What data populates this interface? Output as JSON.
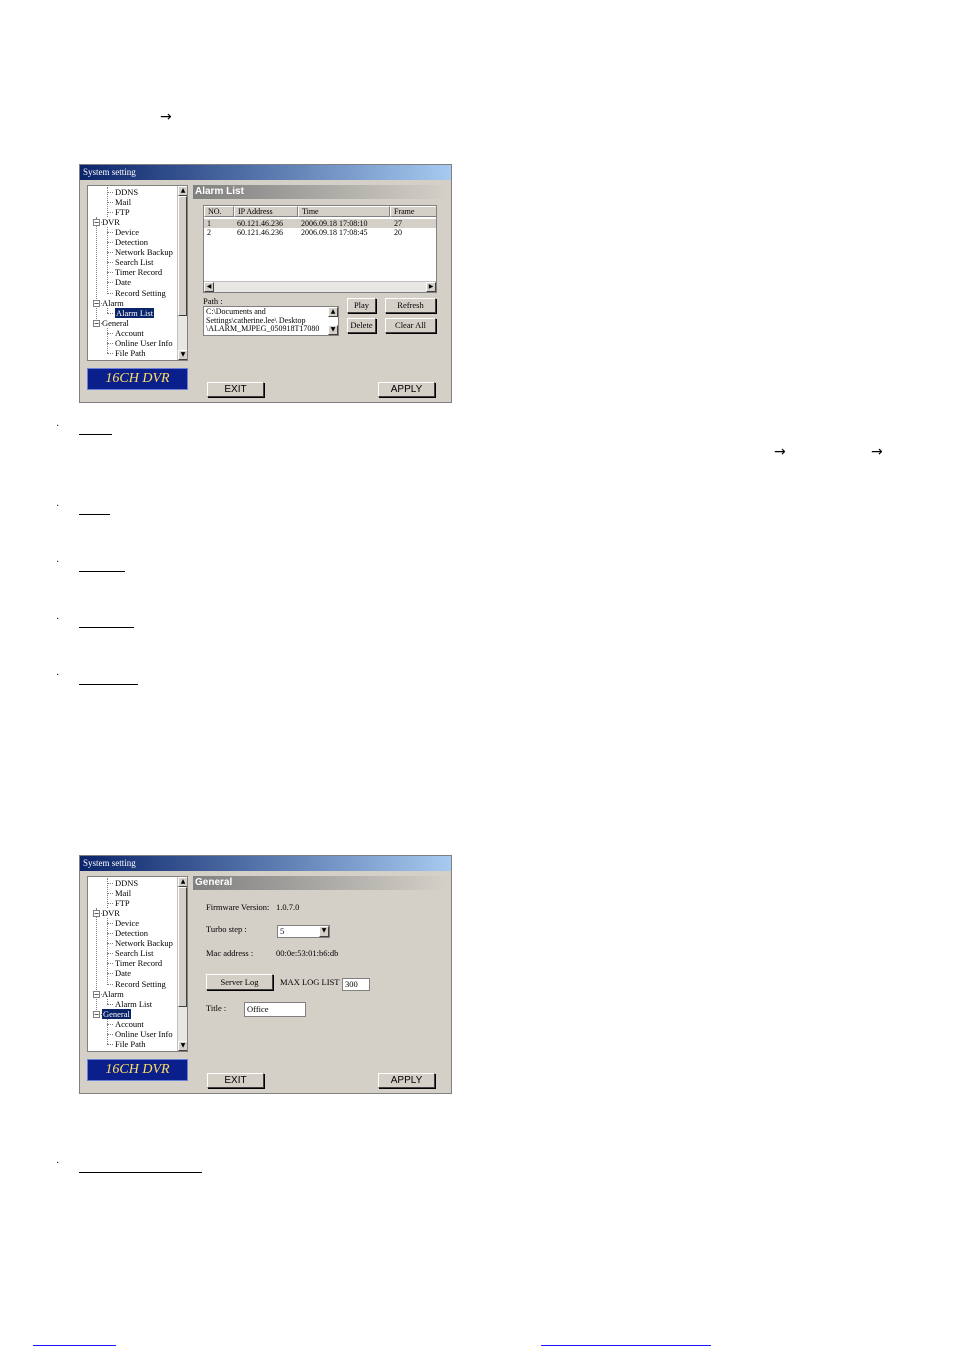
{
  "page": {
    "arrow_glyph": "→"
  },
  "tree": [
    {
      "label": "DDNS",
      "level": 2
    },
    {
      "label": "Mail",
      "level": 2
    },
    {
      "label": "FTP",
      "level": 2
    },
    {
      "label": "DVR",
      "level": 1
    },
    {
      "label": "Device",
      "level": 2
    },
    {
      "label": "Detection",
      "level": 2
    },
    {
      "label": "Network Backup",
      "level": 2
    },
    {
      "label": "Search List",
      "level": 2
    },
    {
      "label": "Timer Record",
      "level": 2
    },
    {
      "label": "Date",
      "level": 2
    },
    {
      "label": "Record Setting",
      "level": 2
    },
    {
      "label": "Alarm",
      "level": 1
    },
    {
      "label": "Alarm List",
      "level": 2
    },
    {
      "label": "General",
      "level": 1
    },
    {
      "label": "Account",
      "level": 2
    },
    {
      "label": "Online User Info",
      "level": 2
    },
    {
      "label": "File Path",
      "level": 2
    }
  ],
  "dialog1": {
    "title": "System setting",
    "panel_title": "Alarm List",
    "selected_tree_item": "Alarm List",
    "columns": [
      "NO.",
      "IP Address",
      "Time",
      "Frame"
    ],
    "rows": [
      [
        "1",
        "60.121.46.236",
        "2006.09.18 17:08:10",
        "27"
      ],
      [
        "2",
        "60.121.46.236",
        "2006.09.18 17:08:45",
        "20"
      ]
    ],
    "path_label": "Path :",
    "path_lines": [
      "C:\\Documents and",
      "Settings\\catherine.lee\\ Desktop",
      "\\ALARM_MJPEG_050918T17080"
    ],
    "play": "Play",
    "refresh": "Refresh",
    "delete": "Delete",
    "clear_all": "Clear All",
    "badge": "16CH DVR",
    "exit": "EXIT",
    "apply": "APPLY"
  },
  "dialog2": {
    "title": "System setting",
    "panel_title": "General",
    "selected_tree_item": "General",
    "firmware_label": "Firmware Version:",
    "firmware_value": "1.0.7.0",
    "turbo_label": "Turbo step :",
    "turbo_value": "5",
    "mac_label": "Mac address :",
    "mac_value": "00:0e:53:01:b6:db",
    "server_log": "Server Log",
    "max_log_label": "MAX LOG LIST",
    "max_log_value": "300",
    "title_label": "Title :",
    "title_value": "Office",
    "badge": "16CH DVR",
    "exit": "EXIT",
    "apply": "APPLY"
  },
  "icons": {
    "scroll_up": "▲",
    "scroll_down": "▼",
    "scroll_left": "◀",
    "scroll_right": "▶",
    "dropdown": "▼",
    "collapse": "−"
  }
}
